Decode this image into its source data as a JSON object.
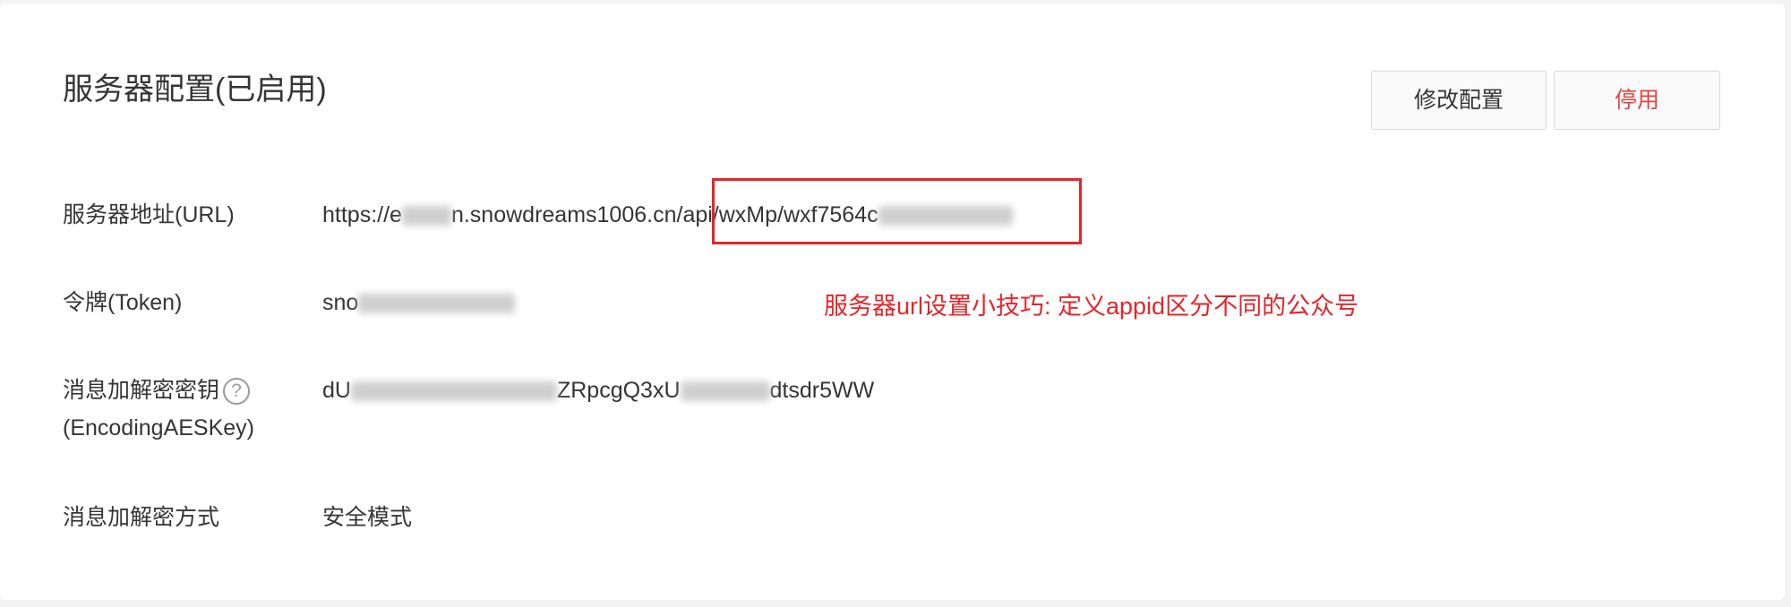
{
  "header": {
    "title": "服务器配置(已启用)",
    "edit_button": "修改配置",
    "disable_button": "停用"
  },
  "rows": {
    "url": {
      "label": "服务器地址(URL)",
      "value_prefix": "https://e",
      "value_mid": "n.snowdreams1006.cn",
      "value_suffix": "/api/wxMp/wxf7564c"
    },
    "token": {
      "label": "令牌(Token)",
      "value_prefix": "sno"
    },
    "aes": {
      "label_line1": "消息加解密密钥",
      "label_line2": "(EncodingAESKey)",
      "help_glyph": "?",
      "value_prefix": "dU",
      "value_mid": "ZRpcgQ3xU",
      "value_suffix": "dtsdr5WW"
    },
    "mode": {
      "label": "消息加解密方式",
      "value": "安全模式"
    }
  },
  "annotation": {
    "text": "服务器url设置小技巧: 定义appid区分不同的公众号",
    "color": "#e3262a"
  },
  "colors": {
    "danger": "#e64340",
    "text": "#353535",
    "background": "#f3f3f3"
  }
}
